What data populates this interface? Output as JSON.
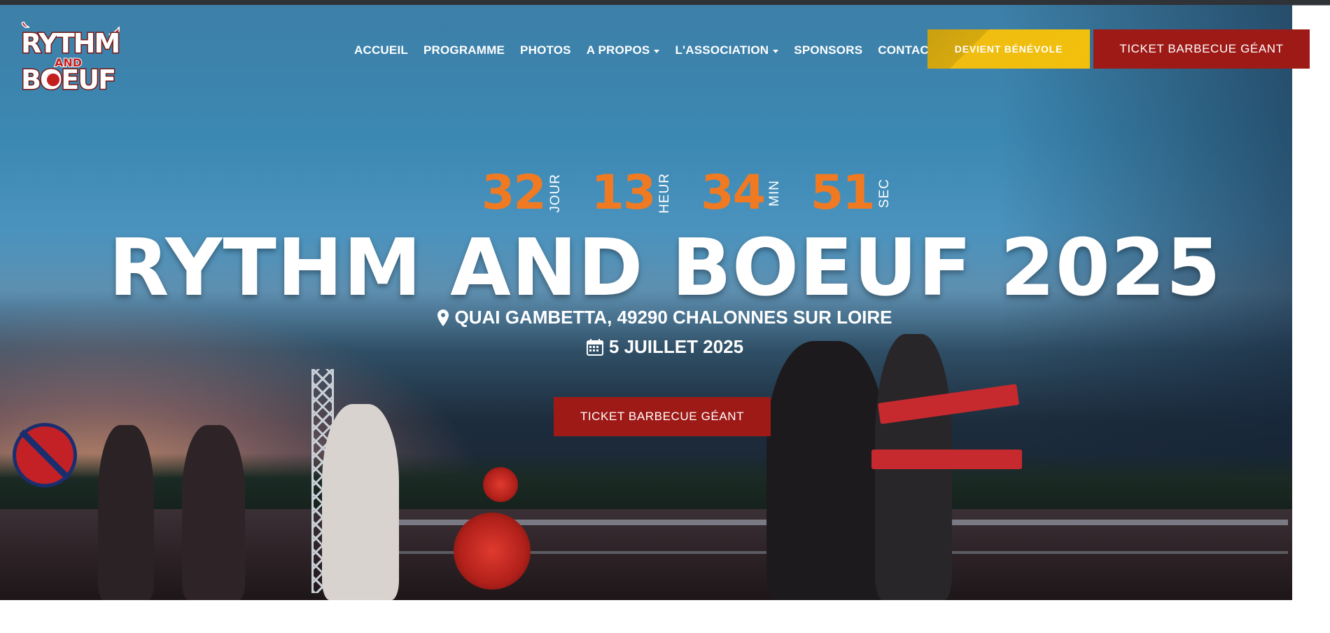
{
  "brand": {
    "logo_alt": "Rythm and Boeuf",
    "colors": {
      "accent_orange": "#f07a22",
      "ticket_red": "#9e1a17",
      "volunteer_yellow": "#f2c00c"
    }
  },
  "nav": {
    "items": [
      {
        "label": "ACCUEIL",
        "dropdown": false
      },
      {
        "label": "PROGRAMME",
        "dropdown": false
      },
      {
        "label": "PHOTOS",
        "dropdown": false
      },
      {
        "label": "A PROPOS",
        "dropdown": true
      },
      {
        "label": "L'ASSOCIATION",
        "dropdown": true
      },
      {
        "label": "SPONSORS",
        "dropdown": false
      },
      {
        "label": "CONTACT",
        "dropdown": false
      }
    ]
  },
  "header_buttons": {
    "volunteer_label": "DEVIENT BÉNÉVOLE",
    "ticket_label": "TICKET BARBECUE GÉANT"
  },
  "countdown": {
    "days": {
      "value": "32",
      "label": "JOUR"
    },
    "hours": {
      "value": "13",
      "label": "HEUR"
    },
    "minutes": {
      "value": "34",
      "label": "MIN"
    },
    "seconds": {
      "value": "51",
      "label": "SEC"
    }
  },
  "hero": {
    "title": "RYTHM AND BOEUF 2025",
    "location": "QUAI GAMBETTA, 49290 CHALONNES SUR LOIRE",
    "date": "5 JUILLET 2025",
    "cta_label": "TICKET BARBECUE GÉANT",
    "location_icon": "map-marker-icon",
    "date_icon": "calendar-icon"
  }
}
